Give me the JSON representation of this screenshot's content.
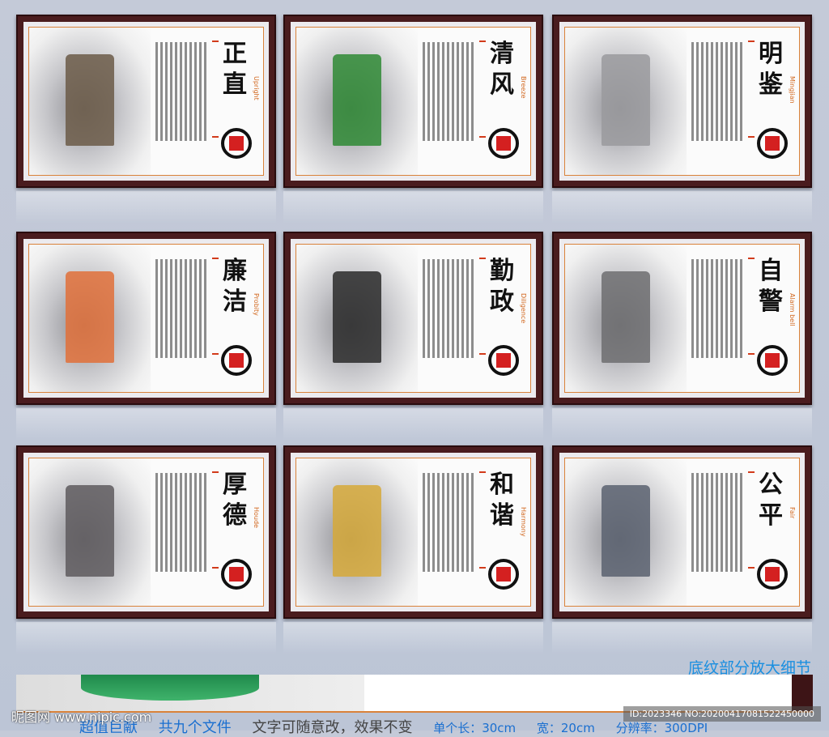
{
  "panels": [
    {
      "title": "正直",
      "english": "Upright",
      "art_color": "#6b5a48"
    },
    {
      "title": "清风",
      "english": "Breeze",
      "art_color": "#2f8a35"
    },
    {
      "title": "明鉴",
      "english": "Mingjian",
      "art_color": "#9a9a9e"
    },
    {
      "title": "廉洁",
      "english": "Probity",
      "art_color": "#e0703a"
    },
    {
      "title": "勤政",
      "english": "Diligence",
      "art_color": "#2a2a2a"
    },
    {
      "title": "自警",
      "english": "Alarm bell",
      "art_color": "#6d6d70"
    },
    {
      "title": "厚德",
      "english": "Houde",
      "art_color": "#5e5a5e"
    },
    {
      "title": "和谐",
      "english": "Harmony",
      "art_color": "#d6a93a"
    },
    {
      "title": "公平",
      "english": "Fair",
      "art_color": "#5a6270"
    }
  ],
  "detail_label": "底纹部分放大细节",
  "info": {
    "a": "超值巨献",
    "b": "共九个文件",
    "c": "文字可随意改，效果不变",
    "d": "单个长：30cm",
    "e": "宽：20cm",
    "f": "分辨率：300DPI"
  },
  "watermark": "昵图网 www.nipic.com",
  "image_id": "ID:2023346 NO:20200417081522450000"
}
